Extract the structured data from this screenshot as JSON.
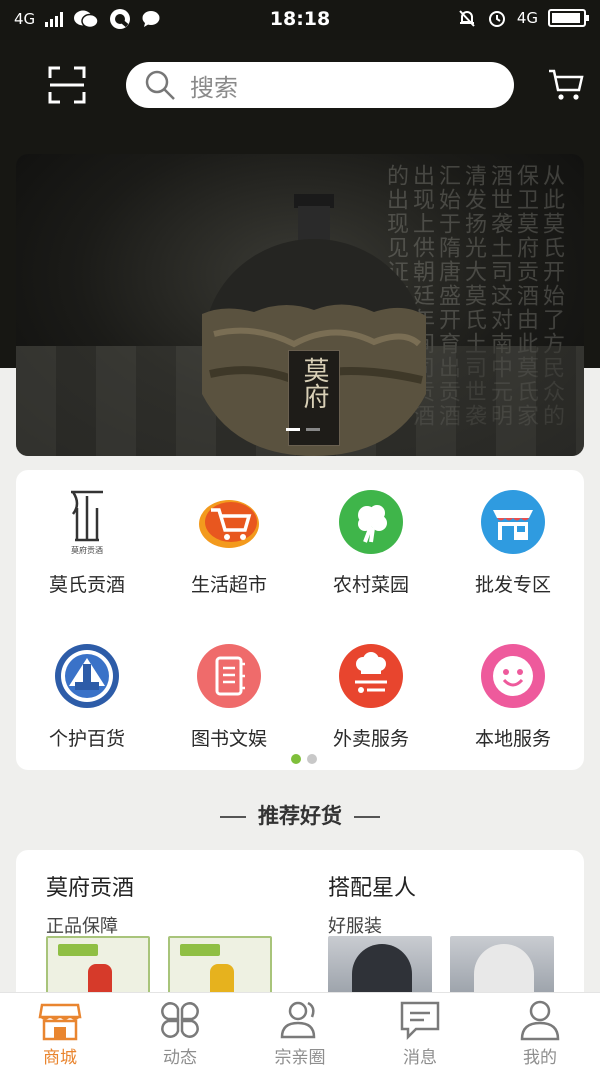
{
  "status_bar": {
    "network_left": "4G",
    "time": "18:18",
    "network_right": "4G",
    "battery_level": 0.92
  },
  "header": {
    "search_placeholder": "搜索"
  },
  "banner": {
    "bottle_label": "莫府",
    "slide_index": 1,
    "slide_count": 2
  },
  "menu": {
    "items": [
      {
        "label": "莫氏贡酒",
        "icon": "mo-wine-logo-icon",
        "icon_caption": "莫府贡酒"
      },
      {
        "label": "生活超市",
        "icon": "shopping-cart-icon",
        "color": "#e8571f"
      },
      {
        "label": "农村菜园",
        "icon": "vegetable-icon",
        "color": "#3fb54a"
      },
      {
        "label": "批发专区",
        "icon": "storefront-icon",
        "color": "#2f9be0"
      },
      {
        "label": "个护百货",
        "icon": "emblem-icon",
        "color": "#2d5ca8"
      },
      {
        "label": "图书文娱",
        "icon": "notebook-icon",
        "color": "#ef6b6b"
      },
      {
        "label": "外卖服务",
        "icon": "chef-hat-icon",
        "color": "#e8452e"
      },
      {
        "label": "本地服务",
        "icon": "smiley-icon",
        "color": "#ee5a9c"
      }
    ],
    "page_index": 0,
    "page_count": 2
  },
  "recommend": {
    "title": "推荐好货",
    "columns": [
      {
        "title": "莫府贡酒",
        "subtitle": "正品保障"
      },
      {
        "title": "搭配星人",
        "subtitle": "好服装"
      }
    ]
  },
  "tabbar": {
    "tabs": [
      {
        "label": "商城",
        "icon": "store-icon",
        "active": true
      },
      {
        "label": "动态",
        "icon": "four-petal-icon",
        "active": false
      },
      {
        "label": "宗亲圈",
        "icon": "people-icon",
        "active": false
      },
      {
        "label": "消息",
        "icon": "chat-icon",
        "active": false
      },
      {
        "label": "我的",
        "icon": "user-icon",
        "active": false
      }
    ],
    "active_color": "#e9852f"
  }
}
